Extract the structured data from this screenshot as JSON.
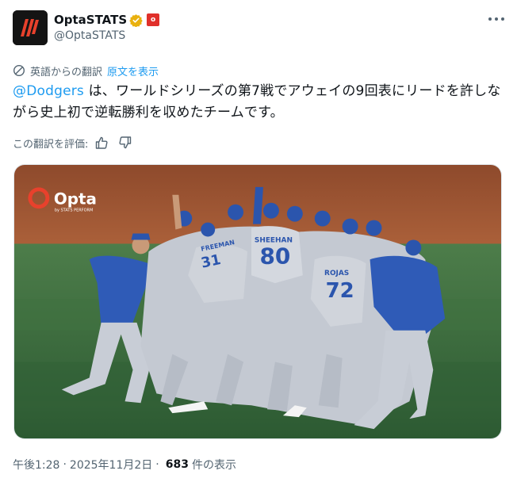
{
  "author": {
    "display_name": "OptaSTATS",
    "handle": "@OptaSTATS",
    "affiliate_badge": "o",
    "verified_color": "#e9b10f"
  },
  "translation": {
    "label": "英語からの翻訳",
    "show_original": "原文を表示"
  },
  "tweet": {
    "mention": "@Dodgers",
    "text": " は、ワールドシリーズの第7戦でアウェイの9回表にリードを許しながら史上初で逆転勝利を収めたチームです。"
  },
  "rating": {
    "label": "この翻訳を評価:"
  },
  "photo": {
    "watermark_brand": "Opta",
    "watermark_sub": "by STATS PERFORM",
    "jersey_numbers": [
      "80",
      "72",
      "31"
    ],
    "jersey_name_1": "SHEEHAN",
    "jersey_name_2": "ROJAS",
    "jersey_name_3": "FREEMAN"
  },
  "meta": {
    "time": "午後1:28",
    "date": "2025年11月2日",
    "separator": "·",
    "views_count": "683",
    "views_label": "件の表示"
  },
  "colors": {
    "accent": "#1d9bf0",
    "dodger_blue": "#2f5bb7",
    "grass": "#3a6d3f",
    "dirt": "#a35a35"
  }
}
